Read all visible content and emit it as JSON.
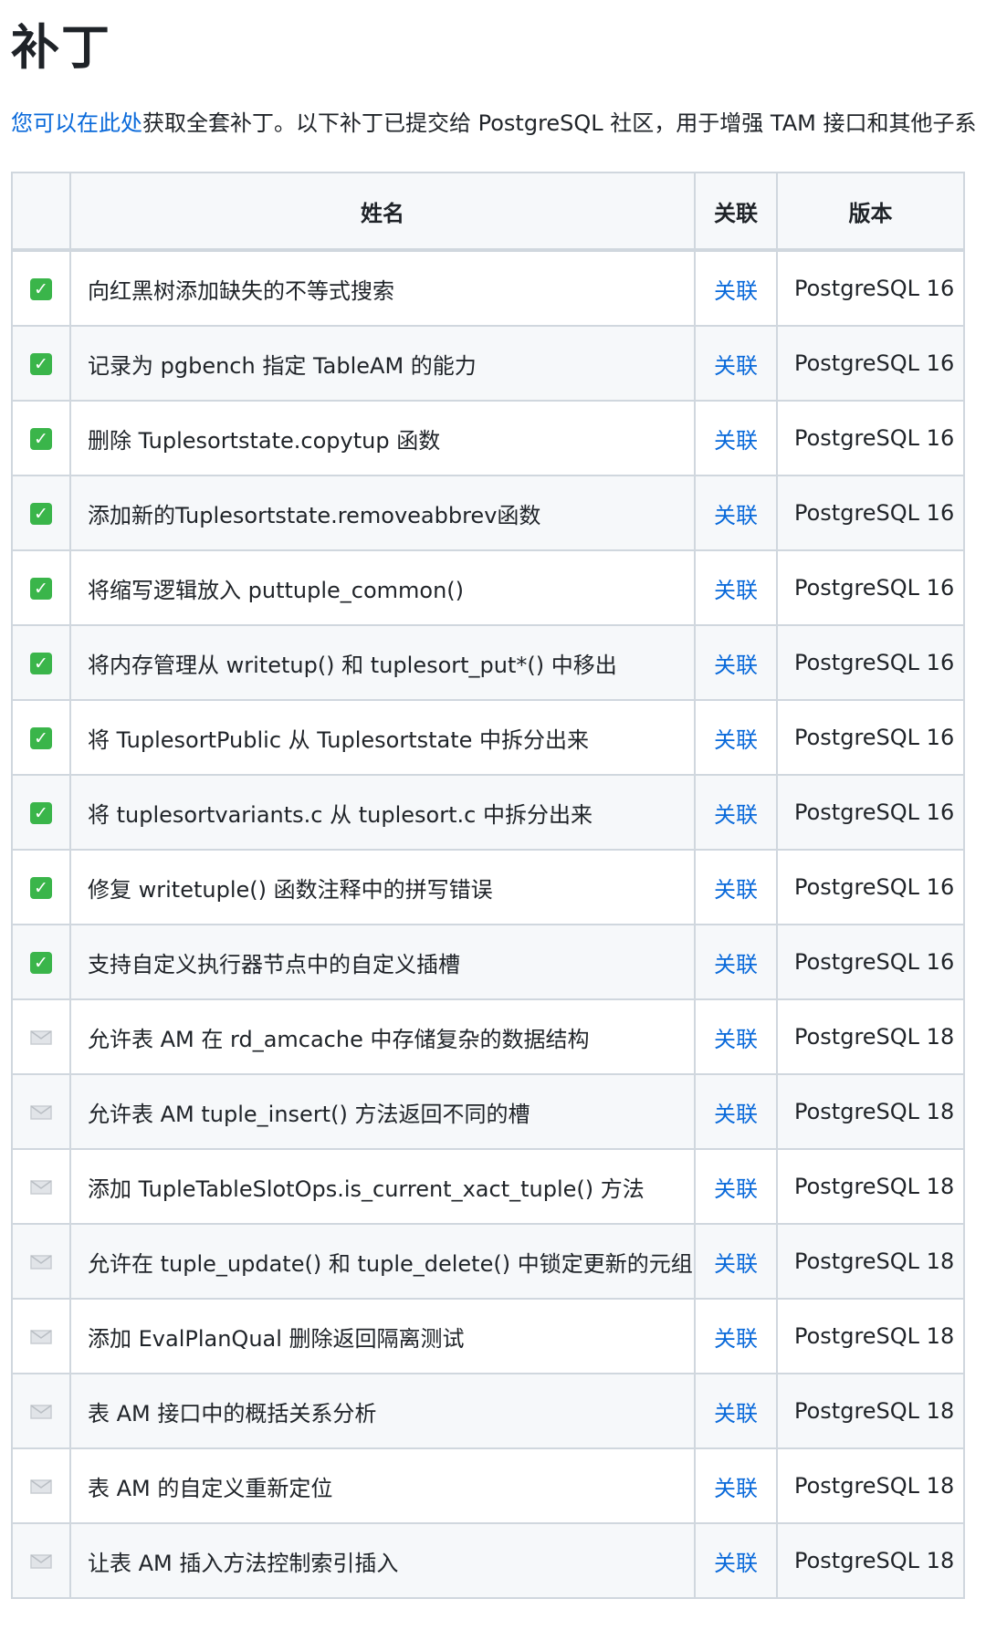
{
  "page": {
    "title": "补丁",
    "intro_link": "您可以在此处",
    "intro_text": "获取全套补丁。以下补丁已提交给 PostgreSQL 社区，用于增强 TAM 接口和其他子系"
  },
  "table": {
    "headers": {
      "status": "",
      "name": "姓名",
      "link": "关联",
      "version": "版本"
    },
    "rows": [
      {
        "status": "merged",
        "name": "向红黑树添加缺失的不等式搜索",
        "link": "关联",
        "version": "PostgreSQL 16"
      },
      {
        "status": "merged",
        "name": "记录为 pgbench 指定 TableAM 的能力",
        "link": "关联",
        "version": "PostgreSQL 16"
      },
      {
        "status": "merged",
        "name": "删除 Tuplesortstate.copytup 函数",
        "link": "关联",
        "version": "PostgreSQL 16"
      },
      {
        "status": "merged",
        "name": "添加新的Tuplesortstate.removeabbrev函数",
        "link": "关联",
        "version": "PostgreSQL 16"
      },
      {
        "status": "merged",
        "name": "将缩写逻辑放入 puttuple_common()",
        "link": "关联",
        "version": "PostgreSQL 16"
      },
      {
        "status": "merged",
        "name": "将内存管理从 writetup() 和 tuplesort_put*() 中移出",
        "link": "关联",
        "version": "PostgreSQL 16"
      },
      {
        "status": "merged",
        "name": "将 TuplesortPublic 从 Tuplesortstate 中拆分出来",
        "link": "关联",
        "version": "PostgreSQL 16"
      },
      {
        "status": "merged",
        "name": "将 tuplesortvariants.c 从 tuplesort.c 中拆分出来",
        "link": "关联",
        "version": "PostgreSQL 16"
      },
      {
        "status": "merged",
        "name": "修复 writetuple() 函数注释中的拼写错误",
        "link": "关联",
        "version": "PostgreSQL 16"
      },
      {
        "status": "merged",
        "name": "支持自定义执行器节点中的自定义插槽",
        "link": "关联",
        "version": "PostgreSQL 16"
      },
      {
        "status": "sent",
        "name": "允许表 AM 在 rd_amcache 中存储复杂的数据结构",
        "link": "关联",
        "version": "PostgreSQL 18"
      },
      {
        "status": "sent",
        "name": "允许表 AM tuple_insert() 方法返回不同的槽",
        "link": "关联",
        "version": "PostgreSQL 18"
      },
      {
        "status": "sent",
        "name": "添加 TupleTableSlotOps.is_current_xact_tuple() 方法",
        "link": "关联",
        "version": "PostgreSQL 18"
      },
      {
        "status": "sent",
        "name": "允许在 tuple_update() 和 tuple_delete() 中锁定更新的元组",
        "link": "关联",
        "version": "PostgreSQL 18"
      },
      {
        "status": "sent",
        "name": "添加 EvalPlanQual 删除返回隔离测试",
        "link": "关联",
        "version": "PostgreSQL 18"
      },
      {
        "status": "sent",
        "name": "表 AM 接口中的概括关系分析",
        "link": "关联",
        "version": "PostgreSQL 18"
      },
      {
        "status": "sent",
        "name": "表 AM 的自定义重新定位",
        "link": "关联",
        "version": "PostgreSQL 18"
      },
      {
        "status": "sent",
        "name": "让表 AM 插入方法控制索引插入",
        "link": "关联",
        "version": "PostgreSQL 18"
      }
    ]
  },
  "icons": {
    "merged": "check-mark-icon",
    "sent": "envelope-icon"
  },
  "colors": {
    "link": "#0969da",
    "check": "#3ab54a",
    "envelope": "#c9cdd2",
    "border": "#d0d7de",
    "stripe": "#f6f8fa"
  }
}
